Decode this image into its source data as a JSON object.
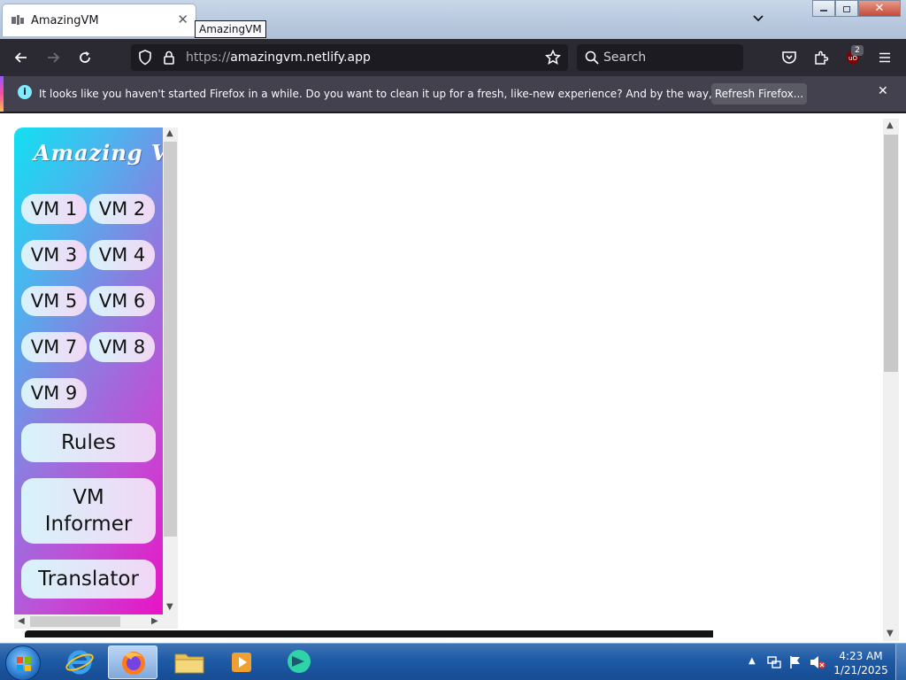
{
  "browser": {
    "tab_title": "AmazingVM",
    "tooltip": "AmazingVM",
    "url_prefix": "https://",
    "url_host": "amazingvm.netlify.app",
    "search_placeholder": "Search",
    "extension_badge": "2"
  },
  "notification": {
    "message": "It looks like you haven't started Firefox in a while. Do you want to clean it up for a fresh, like-new experience? And by the way, welcome back!",
    "button": "Refresh Firefox..."
  },
  "app": {
    "logo_text": "Amazing VM",
    "vm_buttons": [
      "VM 1",
      "VM 2",
      "VM 3",
      "VM 4",
      "VM 5",
      "VM 6",
      "VM 7",
      "VM 8",
      "VM 9"
    ],
    "rules": "Rules",
    "vm_informer_line1": "VM",
    "vm_informer_line2": "Informer",
    "translator": "Translator"
  },
  "taskbar": {
    "time": "4:23 AM",
    "date": "1/21/2025"
  },
  "colors": {
    "panel_gradient": [
      "#12e0f0",
      "#8e7be0",
      "#e813c4"
    ],
    "browser_chrome": "#2b2a33"
  },
  "icons": [
    "firefox-icon",
    "close-icon",
    "chevron-down-icon",
    "back-icon",
    "forward-icon",
    "reload-icon",
    "shield-icon",
    "lock-icon",
    "star-icon",
    "search-icon",
    "pocket-icon",
    "extensions-icon",
    "ublock-icon",
    "menu-icon",
    "info-icon",
    "windows-start-icon",
    "internet-explorer-icon",
    "folder-icon",
    "media-player-icon",
    "chat-app-icon"
  ]
}
